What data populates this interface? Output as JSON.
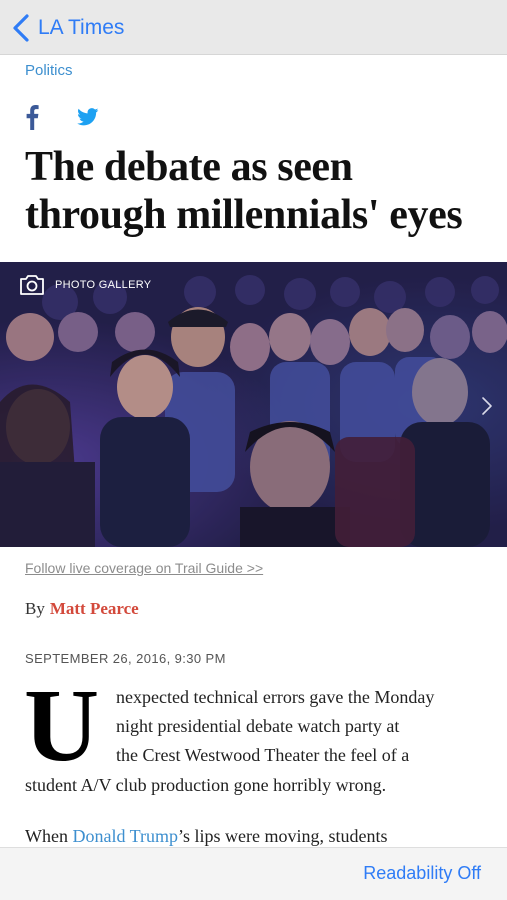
{
  "nav": {
    "back_label": "LA Times"
  },
  "article": {
    "section": "Politics",
    "headline_line1": "The debate as seen",
    "headline_line2": "through millennials' eyes",
    "photo": {
      "gallery_label": "PHOTO GALLERY"
    },
    "trail_link": "Follow live coverage on Trail Guide >>",
    "byline_prefix": "By",
    "author": "Matt Pearce",
    "dateline": "SEPTEMBER 26, 2016, 9:30 PM",
    "drop_cap": "U",
    "body": {
      "line1": "nexpected technical errors gave the Monday",
      "line2": "night presidential debate watch party at",
      "line3": "the Crest Westwood Theater the feel of a",
      "line4": "student A/V club production gone horribly wrong.",
      "line5_before": "When ",
      "line5_link": "Donald Trump",
      "line5_after": "’s lips were moving, students"
    }
  },
  "toolbar": {
    "readability_label": "Readability Off"
  },
  "colors": {
    "ios_blue": "#2f7cf6",
    "section_blue": "#3d8fcf",
    "author_red": "#d3493b",
    "facebook_blue": "#3b5998",
    "twitter_blue": "#1da1f2"
  },
  "icons": [
    "back-chevron-icon",
    "facebook-icon",
    "twitter-icon",
    "camera-icon",
    "chevron-right-icon"
  ]
}
